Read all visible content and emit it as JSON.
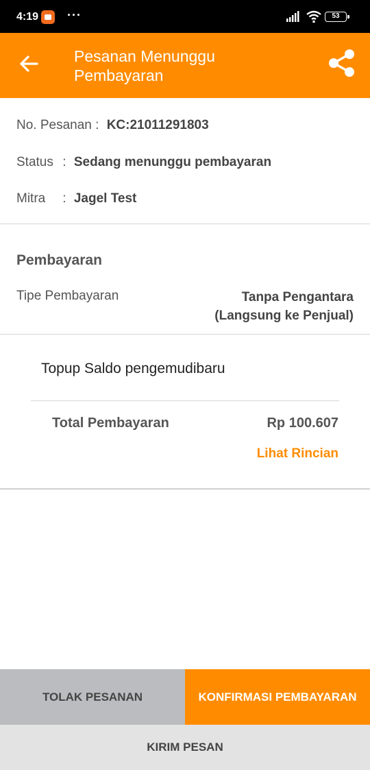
{
  "status_bar": {
    "time": "4:19",
    "dots": "···",
    "battery": "53",
    "icons": [
      "app-notification-icon",
      "signal-icon",
      "wifi-icon",
      "battery-icon"
    ]
  },
  "app_bar": {
    "title": "Pesanan Menunggu Pembayaran",
    "color": "#ff8c00",
    "icons": [
      "back-arrow-icon",
      "share-icon"
    ]
  },
  "order": {
    "number_label": "No. Pesanan",
    "number_value": "KC:21011291803",
    "status_label": "Status",
    "status_value": "Sedang menunggu pembayaran",
    "partner_label": "Mitra",
    "partner_value": "Jagel Test",
    "separator": ":"
  },
  "payment": {
    "heading": "Pembayaran",
    "type_label": "Tipe Pembayaran",
    "type_value": "Tanpa Pengantara (Langsung ke Penjual)"
  },
  "summary": {
    "item": "Topup Saldo pengemudibaru",
    "total_label": "Total Pembayaran",
    "total_value": "Rp 100.607",
    "detail_link": "Lihat Rincian"
  },
  "actions": {
    "reject": "TOLAK PESANAN",
    "confirm": "KONFIRMASI PEMBAYARAN",
    "message": "KIRIM PESAN"
  }
}
